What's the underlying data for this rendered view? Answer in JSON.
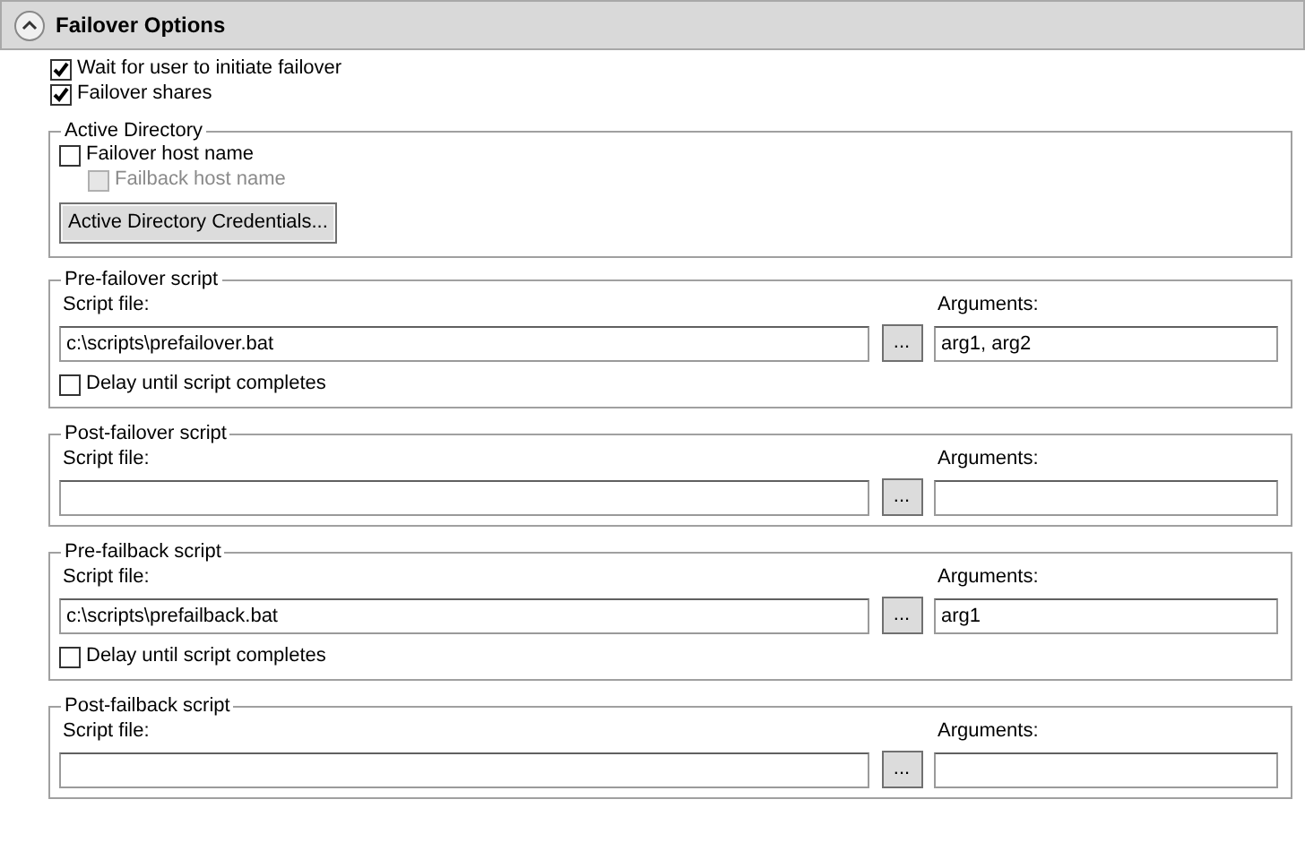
{
  "header": {
    "title": "Failover Options",
    "expanded": true
  },
  "options": [
    {
      "label": "Wait for user to initiate failover",
      "checked": true
    },
    {
      "label": "Failover shares",
      "checked": true
    }
  ],
  "active_directory": {
    "legend": "Active Directory",
    "host_names": [
      {
        "label": "Failover host name",
        "checked": false,
        "disabled": false,
        "children": [
          {
            "label": "Failback host name",
            "checked": false,
            "disabled": true
          }
        ]
      }
    ],
    "button": "Active Directory Credentials..."
  },
  "scripts": [
    {
      "legend": "Pre-failover script",
      "script_label": "Script file:",
      "script_value": "c:\\scripts\\prefailover.bat",
      "browse": "...",
      "args_label": "Arguments:",
      "args_value": "arg1, arg2",
      "delay": {
        "label": "Delay until script completes",
        "checked": false
      }
    },
    {
      "legend": "Post-failover script",
      "script_label": "Script file:",
      "browse": "...",
      "args_label": "Arguments:"
    },
    {
      "legend": "Pre-failback script",
      "script_label": "Script file:",
      "script_value": "c:\\scripts\\prefailback.bat",
      "browse": "...",
      "args_label": "Arguments:",
      "args_value": "arg1",
      "delay": {
        "label": "Delay until script completes",
        "checked": false
      }
    },
    {
      "legend": "Post-failback script",
      "script_label": "Script file:",
      "browse": "...",
      "args_label": "Arguments:"
    }
  ]
}
